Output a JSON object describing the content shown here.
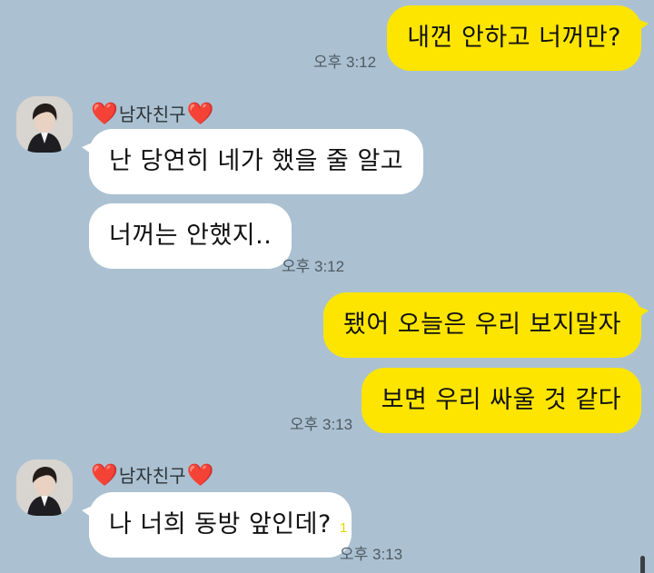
{
  "sender": {
    "name": "남자친구",
    "heart": "❤️"
  },
  "messages": {
    "m1": {
      "text": "내껀 안하고 너꺼만?",
      "time": "오후 3:12"
    },
    "m2": {
      "text": "난 당연히 네가 했을 줄 알고"
    },
    "m3": {
      "text": "너꺼는 안했지..",
      "time": "오후 3:12"
    },
    "m4": {
      "text": "됐어 오늘은 우리 보지말자"
    },
    "m5": {
      "text": "보면 우리 싸울 것 같다",
      "time": "오후 3:13"
    },
    "m6": {
      "text": "나 너희 동방 앞인데?",
      "time": "오후 3:13",
      "unread": "1"
    }
  },
  "colors": {
    "background": "#abc1d1",
    "my_bubble": "#fee500",
    "their_bubble": "#ffffff",
    "heart": "#e0262e"
  },
  "icons": [
    "profile-avatar",
    "heart-icon"
  ]
}
